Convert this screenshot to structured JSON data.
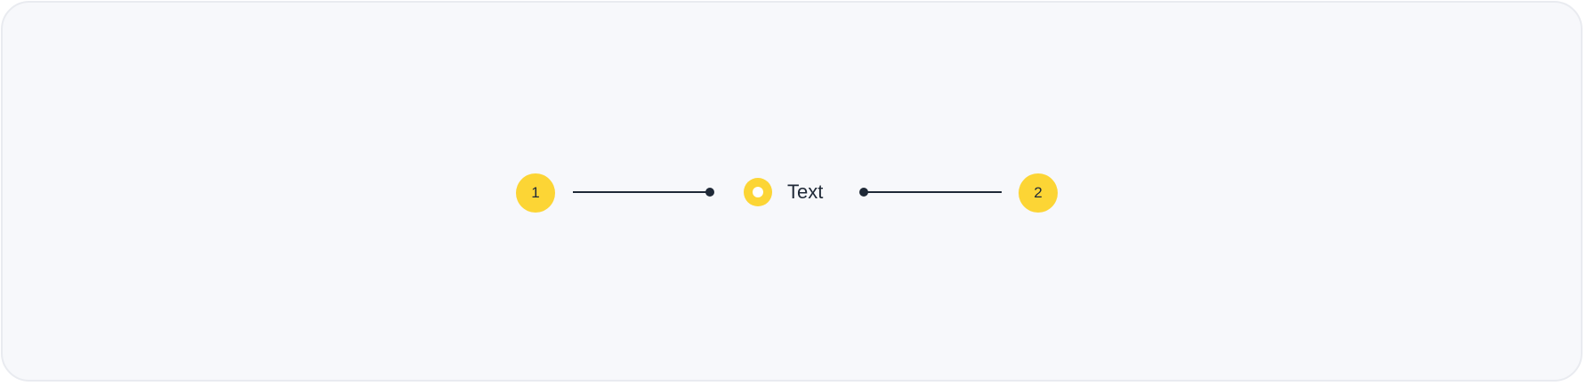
{
  "diagram": {
    "callouts": [
      {
        "number": "1"
      },
      {
        "number": "2"
      }
    ],
    "radio": {
      "label": "Text"
    }
  },
  "colors": {
    "frame_background": "#f7f8fb",
    "frame_border": "#e9ebf0",
    "badge_fill": "#fcd535",
    "ink": "#1f2937",
    "radio_inner": "#ffffff"
  },
  "icons": {
    "radio": "radio-button-icon",
    "connector_end": "dot-marker"
  }
}
